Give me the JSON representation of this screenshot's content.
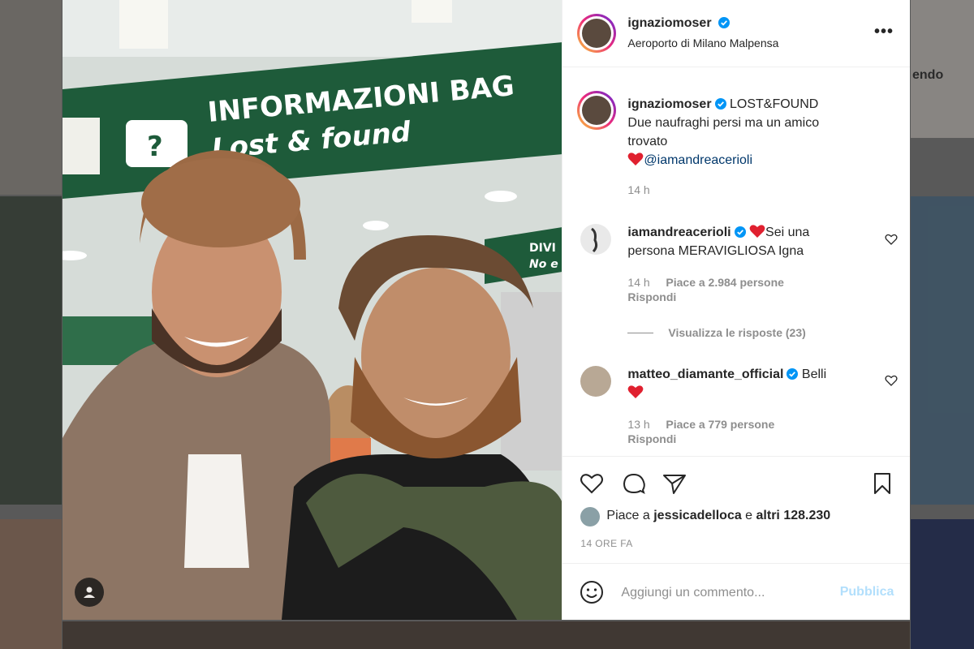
{
  "background": {
    "partial_text": "endo"
  },
  "post": {
    "username": "ignaziomoser",
    "location": "Aeroporto di Milano Malpensa",
    "more_label": "•••",
    "photo": {
      "sign_main": "INFORMAZIONI BAG",
      "sign_sub": "Lost & found",
      "sign_right_1": "DIVI",
      "sign_right_2": "No e"
    },
    "caption": {
      "username": "ignaziomoser",
      "line1": "LOST&FOUND",
      "line2": "Due naufraghi persi ma un amico",
      "line3": "trovato",
      "mention": "@iamandreacerioli",
      "time": "14 h"
    },
    "comments": [
      {
        "username": "iamandreacerioli",
        "text1": "Sei una",
        "text2": "persona MERAVIGLIOSA Igna",
        "time": "14 h",
        "likes": "Piace a 2.984 persone",
        "reply": "Rispondi",
        "view_replies": "Visualizza le risposte (23)"
      },
      {
        "username": "matteo_diamante_official",
        "text1": "Belli",
        "time": "13 h",
        "likes": "Piace a 779 persone",
        "reply": "Rispondi"
      }
    ],
    "likes": {
      "prefix": "Piace a ",
      "user": "jessicadelloca",
      "middle": " e ",
      "others": "altri 128.230"
    },
    "time_ago": "14 ORE FA",
    "comment_placeholder": "Aggiungi un commento...",
    "publish_label": "Pubblica"
  },
  "colors": {
    "verified": "#0095f6",
    "heart": "#ed4956",
    "mention": "#00376b",
    "publish_disabled": "#b2dffc"
  }
}
